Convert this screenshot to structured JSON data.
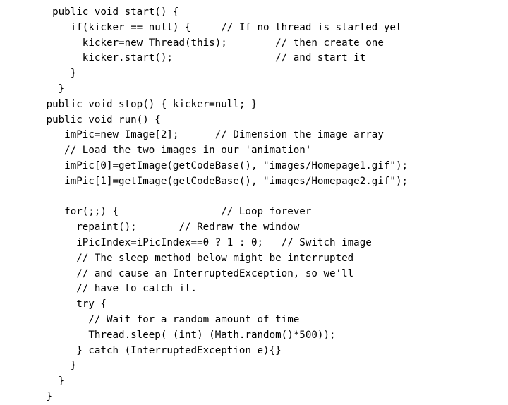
{
  "slide": {
    "kind": "code-listing-slide",
    "background_color": "#ffffff",
    "text_color": "#000000",
    "language": "java"
  },
  "code": {
    "lines": [
      "  public void start() {",
      "     if(kicker == null) {     // If no thread is started yet",
      "       kicker=new Thread(this);        // then create one",
      "       kicker.start();                 // and start it",
      "     }",
      "   }",
      " public void stop() { kicker=null; }",
      " public void run() {",
      "    imPic=new Image[2];      // Dimension the image array",
      "    // Load the two images in our 'animation'",
      "    imPic[0]=getImage(getCodeBase(), \"images/Homepage1.gif\");",
      "    imPic[1]=getImage(getCodeBase(), \"images/Homepage2.gif\");",
      "",
      "    for(;;) {                 // Loop forever",
      "      repaint();       // Redraw the window",
      "      iPicIndex=iPicIndex==0 ? 1 : 0;   // Switch image",
      "      // The sleep method below might be interrupted",
      "      // and cause an InterruptedException, so we'll",
      "      // have to catch it.",
      "      try {",
      "        // Wait for a random amount of time",
      "        Thread.sleep( (int) (Math.random()*500));",
      "      } catch (InterruptedException e){}",
      "     }",
      "   }",
      " }"
    ]
  }
}
